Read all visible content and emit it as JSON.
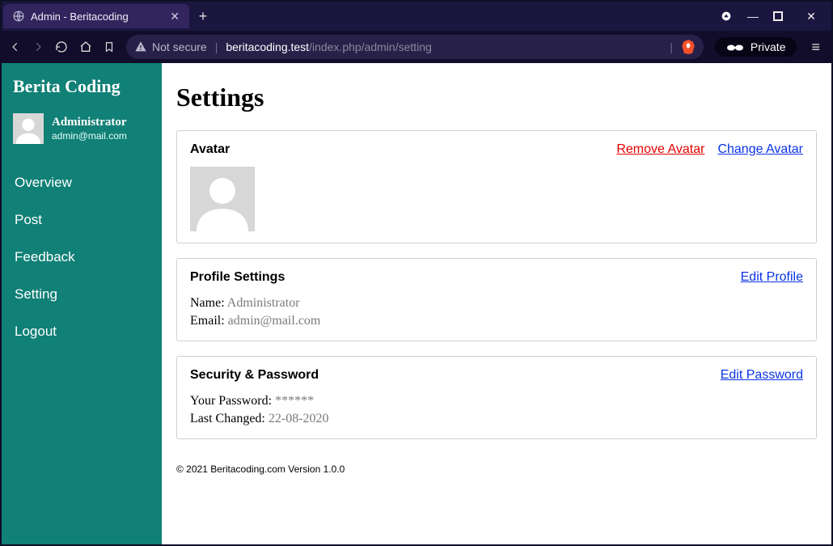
{
  "browser": {
    "tab_title": "Admin - Beritacoding",
    "not_secure_label": "Not secure",
    "url_host": "beritacoding.test",
    "url_path": "/index.php/admin/setting",
    "private_label": "Private"
  },
  "sidebar": {
    "brand": "Berita Coding",
    "user": {
      "name": "Administrator",
      "email": "admin@mail.com"
    },
    "items": [
      {
        "label": "Overview"
      },
      {
        "label": "Post"
      },
      {
        "label": "Feedback"
      },
      {
        "label": "Setting"
      },
      {
        "label": "Logout"
      }
    ]
  },
  "page": {
    "title": "Settings",
    "avatar_card": {
      "title": "Avatar",
      "remove_label": "Remove Avatar",
      "change_label": "Change Avatar"
    },
    "profile_card": {
      "title": "Profile Settings",
      "edit_label": "Edit Profile",
      "name_label": "Name:",
      "name_value": "Administrator",
      "email_label": "Email:",
      "email_value": "admin@mail.com"
    },
    "security_card": {
      "title": "Security & Password",
      "edit_label": "Edit Password",
      "password_label": "Your Password:",
      "password_value": "******",
      "changed_label": "Last Changed:",
      "changed_value": "22-08-2020"
    },
    "footer": "© 2021 Beritacoding.com Version 1.0.0"
  }
}
